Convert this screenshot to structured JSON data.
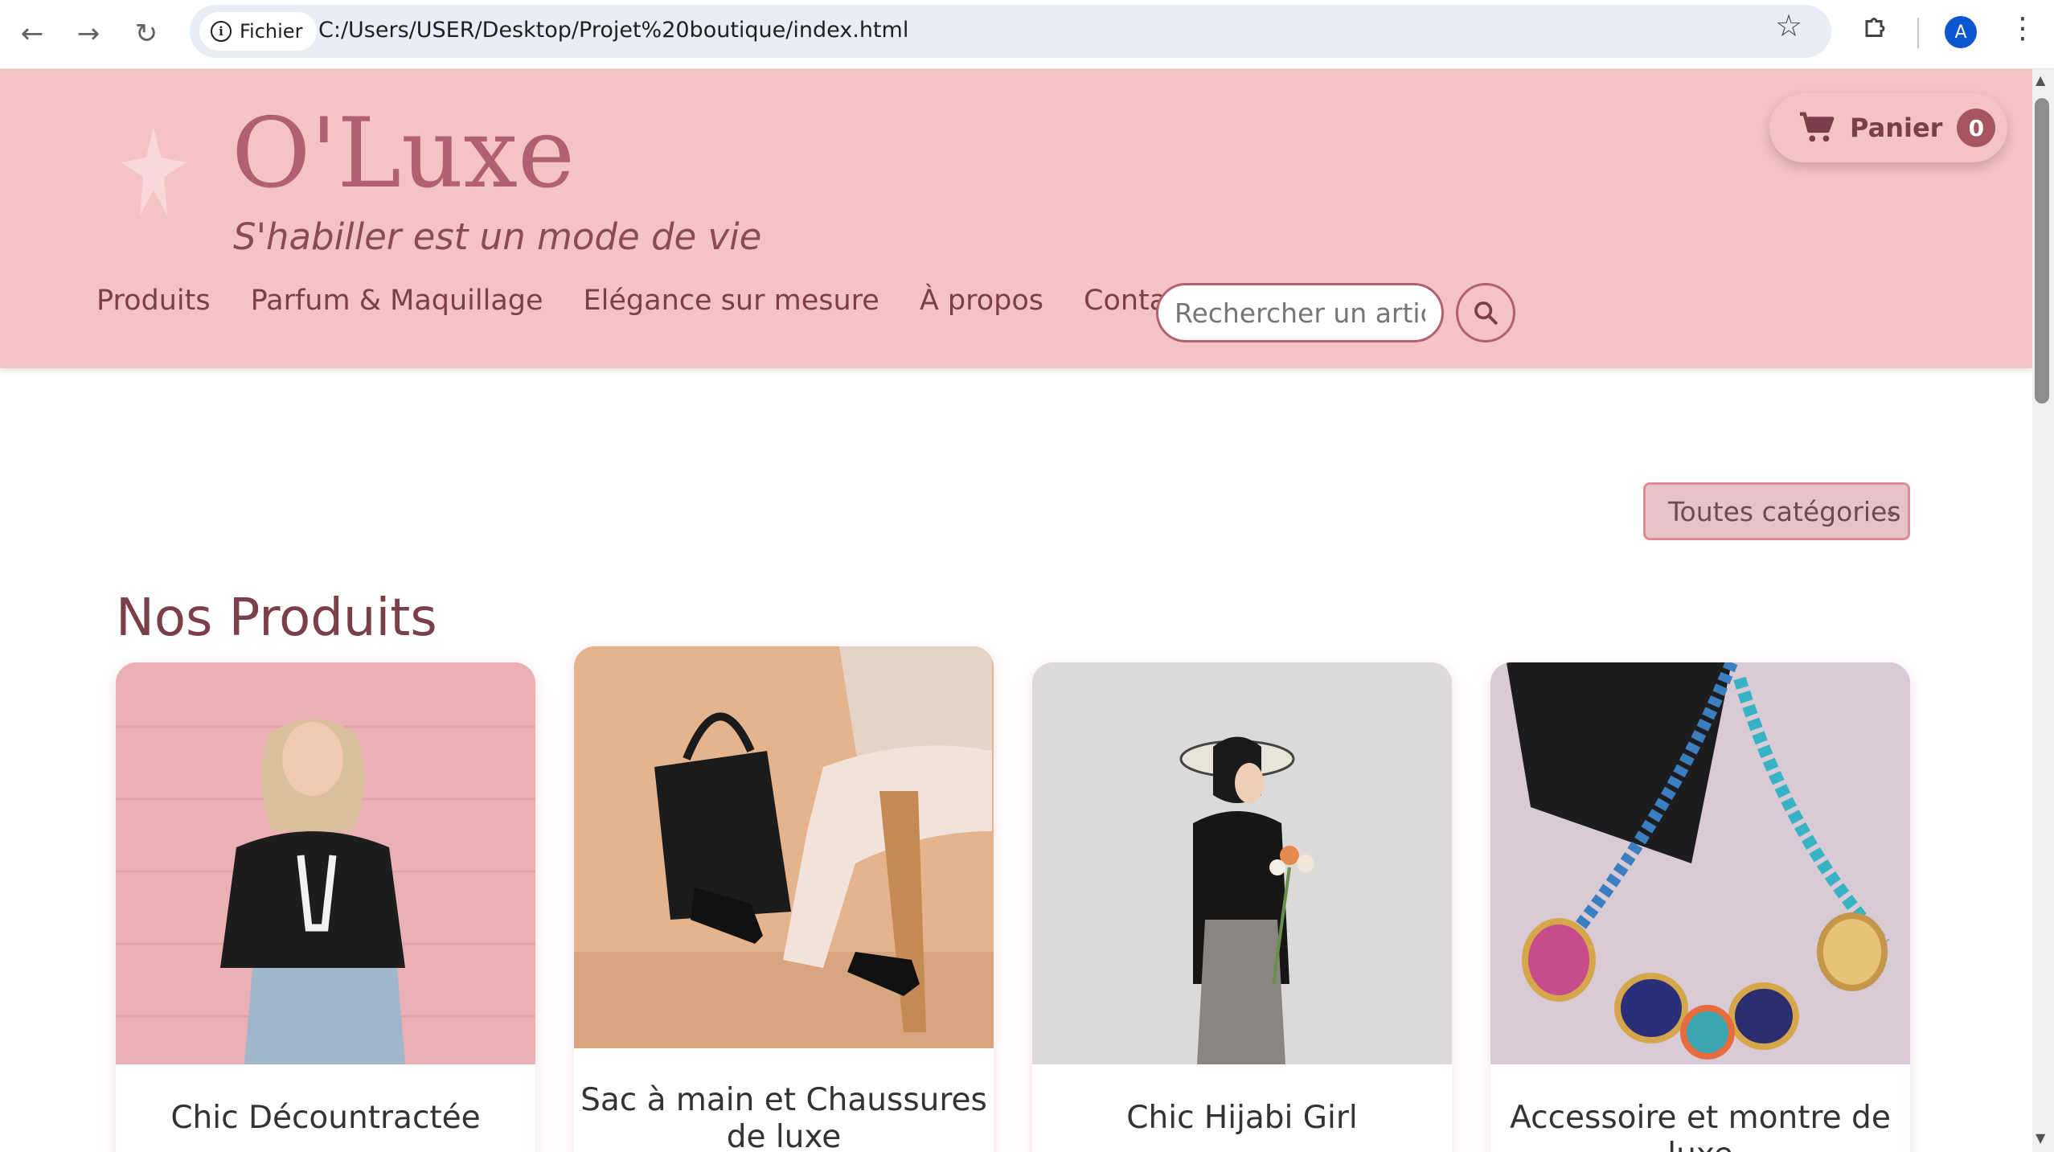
{
  "browser": {
    "site_chip_label": "Fichier",
    "url": "C:/Users/USER/Desktop/Projet%20boutique/index.html",
    "profile_initial": "A"
  },
  "header": {
    "brand": "O'Luxe",
    "tagline": "S'habiller est un mode de vie",
    "nav": [
      "Produits",
      "Parfum & Maquillage",
      "Elégance sur mesure",
      "À propos",
      "Contact"
    ],
    "search_placeholder": "Rechercher un article",
    "cart_label": "Panier",
    "cart_count": "0",
    "colors": {
      "header_bg": "#f4c3c5",
      "brand": "#b06070",
      "accent": "#a6555f"
    }
  },
  "filter": {
    "selected": "Toutes catégories"
  },
  "products": {
    "title": "Nos Produits",
    "items": [
      {
        "name": "Chic Décountractée"
      },
      {
        "name": "Sac à main et Chaussures de luxe"
      },
      {
        "name": "Chic Hijabi Girl"
      },
      {
        "name": "Accessoire et montre de luxe"
      }
    ]
  }
}
